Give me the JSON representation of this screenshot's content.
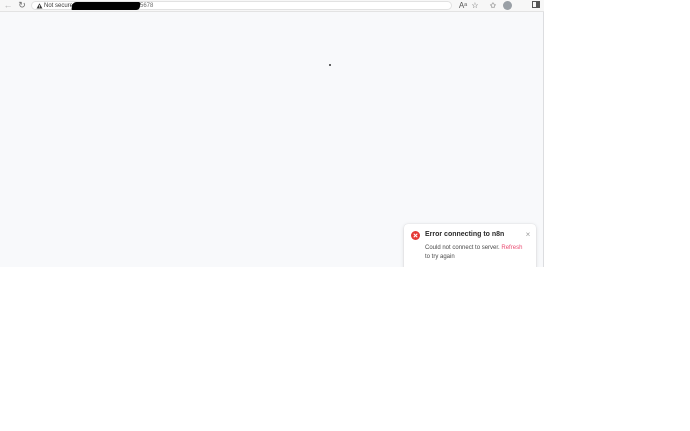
{
  "browser": {
    "security_label": "Not secure",
    "url_visible_suffix": "5678",
    "icons": {
      "back": "back-arrow-icon",
      "reload": "reload-icon",
      "read_aloud": "read-aloud-icon",
      "favorite": "star-icon",
      "favorites": "favorites-icon",
      "profile": "avatar",
      "split_screen": "split-screen-icon"
    },
    "read_aloud_glyph": "Aᵃ"
  },
  "toast": {
    "title": "Error connecting to n8n",
    "message": "Could not connect to server.",
    "link": "Refresh",
    "message_tail": "to try again",
    "accent_color": "#e53935",
    "link_color": "#ea4b71"
  }
}
